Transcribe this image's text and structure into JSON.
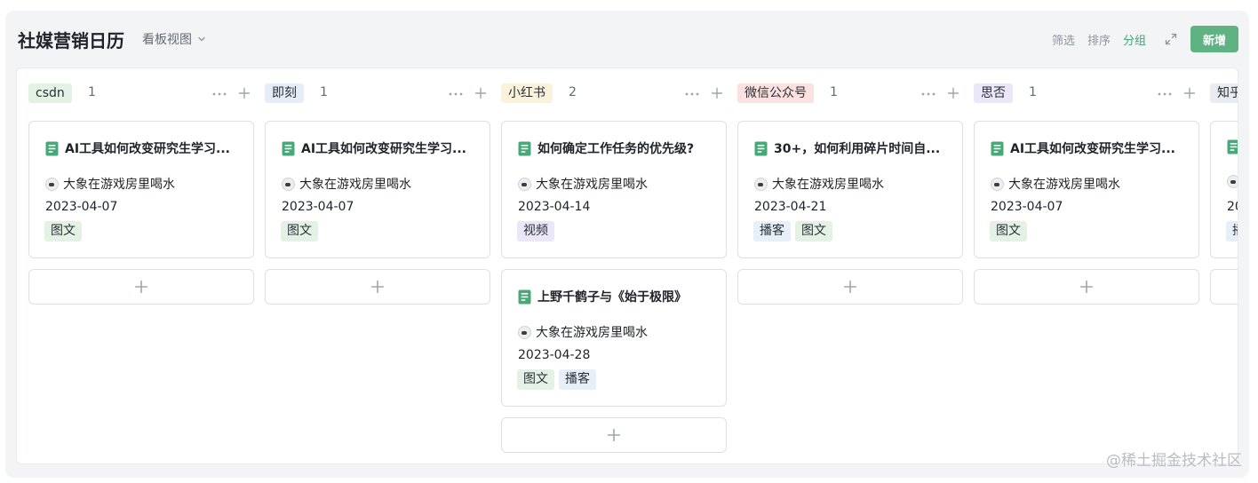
{
  "header": {
    "title": "社媒营销日历",
    "view_label": "看板视图",
    "filter_label": "筛选",
    "sort_label": "排序",
    "group_label": "分组",
    "new_label": "新增"
  },
  "colors": {
    "accent": "#3fa676",
    "new_button": "#5fb383",
    "doc_icon": "#4ba779"
  },
  "icons": {
    "view_dropdown": "chevron-down-icon",
    "expand": "expand-icon",
    "more": "more-horizontal-icon",
    "add": "plus-icon",
    "doc": "document-icon"
  },
  "columns": [
    {
      "name": "csdn",
      "count": "1",
      "color": "#e4f2e6",
      "cards": [
        {
          "title": "AI工具如何改变研究生学习...",
          "author": "大象在游戏房里喝水",
          "date": "2023-04-07",
          "tags": [
            "图文"
          ]
        }
      ]
    },
    {
      "name": "即刻",
      "count": "1",
      "color": "#e5eef8",
      "cards": [
        {
          "title": "AI工具如何改变研究生学习...",
          "author": "大象在游戏房里喝水",
          "date": "2023-04-07",
          "tags": [
            "图文"
          ]
        }
      ]
    },
    {
      "name": "小红书",
      "count": "2",
      "color": "#fbf2dc",
      "cards": [
        {
          "title": "如何确定工作任务的优先级?",
          "author": "大象在游戏房里喝水",
          "date": "2023-04-14",
          "tags": [
            "视频"
          ]
        },
        {
          "title": "上野千鹤子与《始于极限》",
          "author": "大象在游戏房里喝水",
          "date": "2023-04-28",
          "tags": [
            "图文",
            "播客"
          ]
        }
      ]
    },
    {
      "name": "微信公众号",
      "count": "1",
      "color": "#fbe1df",
      "cards": [
        {
          "title": "30+，如何利用碎片时间自...",
          "author": "大象在游戏房里喝水",
          "date": "2023-04-21",
          "tags": [
            "播客",
            "图文"
          ]
        }
      ]
    },
    {
      "name": "思否",
      "count": "1",
      "color": "#ebe7f8",
      "cards": [
        {
          "title": "AI工具如何改变研究生学习...",
          "author": "大象在游戏房里喝水",
          "date": "2023-04-07",
          "tags": [
            "图文"
          ]
        }
      ]
    },
    {
      "name": "知乎",
      "count": "",
      "color": "#e9ecf0",
      "cards": [
        {
          "title": "",
          "author": "",
          "date": "20",
          "tags": [
            "播"
          ]
        }
      ]
    }
  ],
  "tag_colors": {
    "图文": "#e4f2e6",
    "视频": "#ebe7f8",
    "播客": "#e7f0f8",
    "播": "#e7f0f8"
  },
  "watermark": "@稀土掘金技术社区"
}
